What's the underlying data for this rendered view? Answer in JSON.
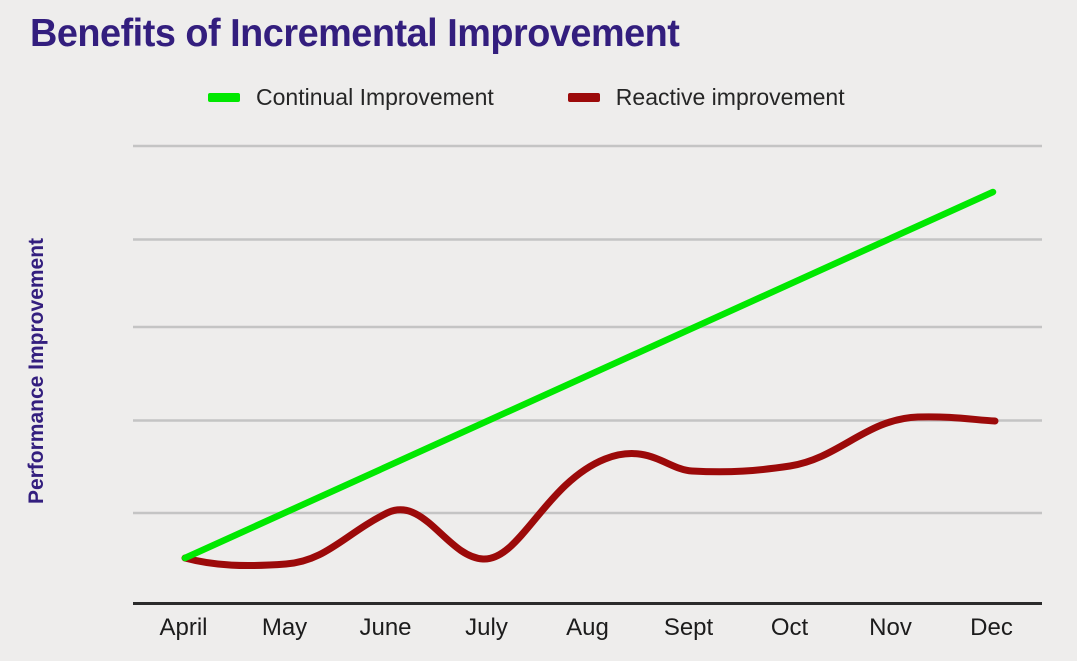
{
  "title": "Benefits of Incremental Improvement",
  "colors": {
    "background": "#eeedec",
    "title": "#331e7e",
    "axis_title": "#331e7e",
    "gridline": "#c4c4c4",
    "axis_line": "#2b2b2b",
    "tick_label": "#1c1c1c",
    "legend_label": "#262626",
    "continual": "#00e800",
    "reactive": "#9c0a0a"
  },
  "legend": {
    "position": "top",
    "items": [
      {
        "label": "Continual Improvement",
        "color": "#00e800",
        "swatch": "line-swatch"
      },
      {
        "label": "Reactive improvement",
        "color": "#9c0a0a",
        "swatch": "line-swatch"
      }
    ]
  },
  "axes": {
    "y_title": "Performance Improvement",
    "y_tick_labels": [],
    "x_tick_labels": [
      "April",
      "May",
      "June",
      "July",
      "Aug",
      "Sept",
      "Oct",
      "Nov",
      "Dec"
    ]
  },
  "chart_data": {
    "type": "line",
    "title": "Benefits of Incremental Improvement",
    "xlabel": "",
    "ylabel": "Performance Improvement",
    "categories": [
      "April",
      "May",
      "June",
      "July",
      "Aug",
      "Sept",
      "Oct",
      "Nov",
      "Dec"
    ],
    "ylim": [
      0,
      100
    ],
    "yticks": [
      0,
      20,
      40,
      60,
      80,
      100
    ],
    "ytick_labels_shown": false,
    "grid": "horizontal",
    "legend_position": "top",
    "series": [
      {
        "name": "Continual Improvement",
        "color": "#00e800",
        "smoothing": "straight",
        "values": [
          10,
          21.5,
          33,
          44.5,
          56,
          67.5,
          79,
          90.5,
          100
        ]
      },
      {
        "name": "Reactive improvement",
        "color": "#9c0a0a",
        "smoothing": "spline",
        "values": [
          10,
          9,
          20,
          10,
          31,
          29,
          28,
          40,
          39.5
        ]
      }
    ],
    "annotations": [
      "Continual Improvement rises as a straight diagonal line from April to December.",
      "Reactive improvement is a wavy curve: flat dip in May, bump at June, trough at July, step up to a plateau in Aug-Oct, then another step up to a plateau in Nov-Dec."
    ]
  }
}
